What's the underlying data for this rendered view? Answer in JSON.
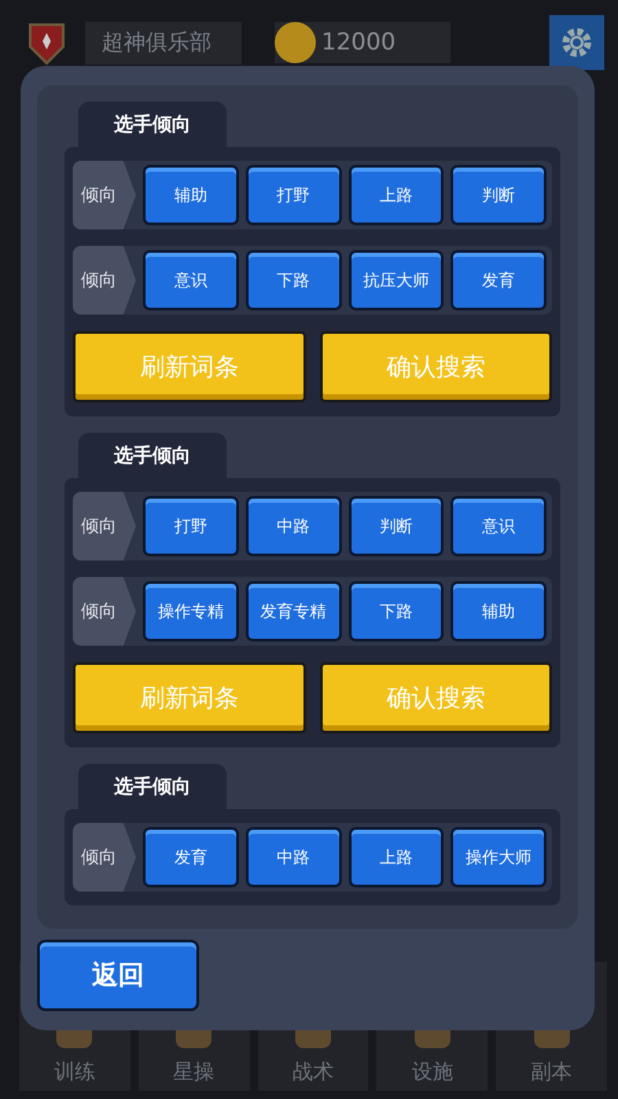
{
  "top_bar": {
    "club_name": "超神俱乐部",
    "coins": "12000"
  },
  "dialog": {
    "sections": [
      {
        "title": "选手倾向",
        "rows": [
          {
            "label": "倾向",
            "options": [
              "辅助",
              "打野",
              "上路",
              "判断"
            ]
          },
          {
            "label": "倾向",
            "options": [
              "意识",
              "下路",
              "抗压大师",
              "发育"
            ]
          }
        ],
        "actions": [
          "刷新词条",
          "确认搜索"
        ]
      },
      {
        "title": "选手倾向",
        "rows": [
          {
            "label": "倾向",
            "options": [
              "打野",
              "中路",
              "判断",
              "意识"
            ]
          },
          {
            "label": "倾向",
            "options": [
              "操作专精",
              "发育专精",
              "下路",
              "辅助"
            ]
          }
        ],
        "actions": [
          "刷新词条",
          "确认搜索"
        ]
      },
      {
        "title": "选手倾向",
        "rows": [
          {
            "label": "倾向",
            "options": [
              "发育",
              "中路",
              "上路",
              "操作大师"
            ]
          }
        ]
      }
    ],
    "back_button": "返回"
  },
  "bottom_nav": [
    {
      "label": "训练"
    },
    {
      "label": "星操"
    },
    {
      "label": "战术"
    },
    {
      "label": "设施"
    },
    {
      "label": "副本"
    }
  ]
}
